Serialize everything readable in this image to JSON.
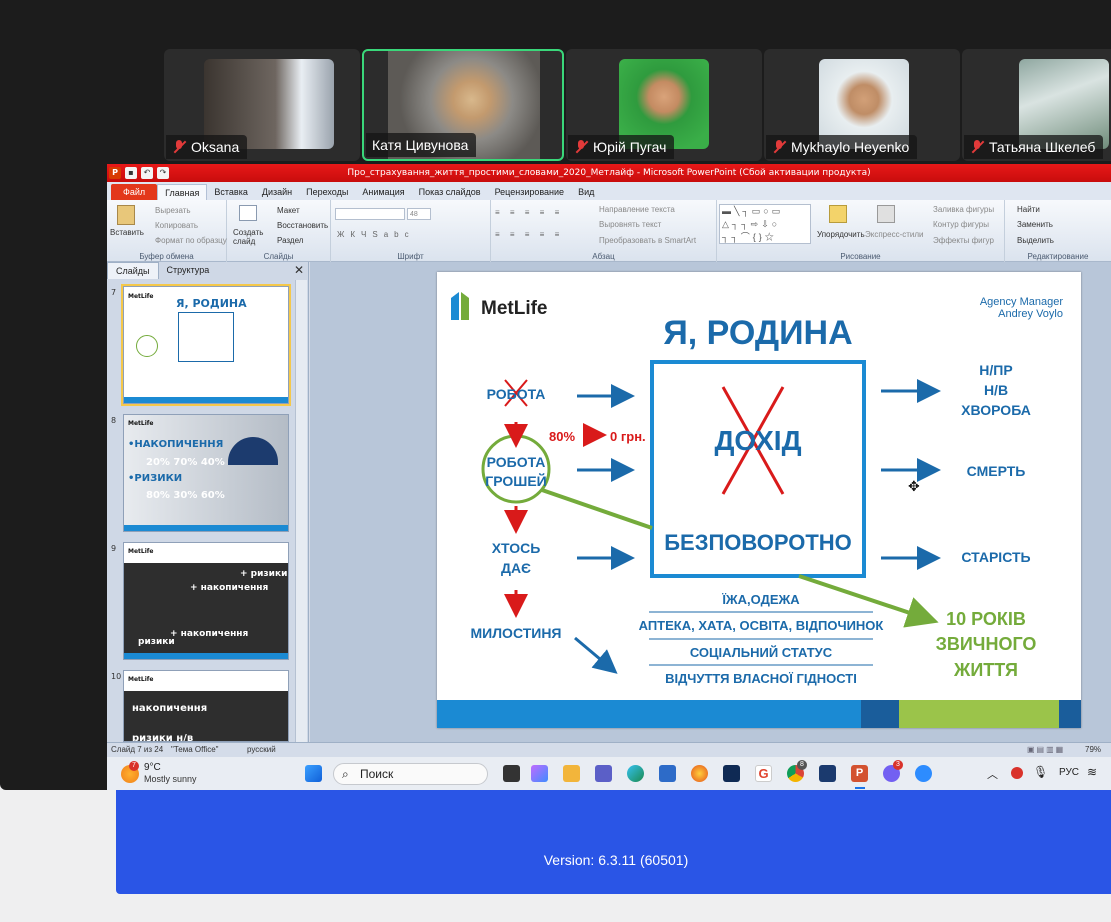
{
  "participants": [
    {
      "name": "Oksana",
      "muted": true
    },
    {
      "name": "Катя Цивунова",
      "muted": false,
      "active": true
    },
    {
      "name": "Юрій Пугач",
      "muted": true
    },
    {
      "name": "Mykhaylo Heyenko",
      "muted": true
    },
    {
      "name": "Татьяна Шкелеб",
      "muted": true
    }
  ],
  "ppt": {
    "title": "Про_страхування_життя_простими_словами_2020_Метлайф - Microsoft PowerPoint (Сбой активации продукта)",
    "tabs": [
      "Файл",
      "Главная",
      "Вставка",
      "Дизайн",
      "Переходы",
      "Анимация",
      "Показ слайдов",
      "Рецензирование",
      "Вид"
    ],
    "ribbon": {
      "clipboard": {
        "paste": "Вставить",
        "cut": "Вырезать",
        "copy": "Копировать",
        "format": "Формат по образцу",
        "group": "Буфер обмена"
      },
      "slides": {
        "new": "Создать слайд",
        "layout": "Макет",
        "reset": "Восстановить",
        "section": "Раздел",
        "group": "Слайды"
      },
      "font": {
        "size": "48",
        "group": "Шрифт"
      },
      "paragraph": {
        "dir": "Направление текста",
        "align": "Выровнять текст",
        "smartart": "Преобразовать в SmartArt",
        "group": "Абзац"
      },
      "drawing": {
        "arrange": "Упорядочить",
        "styles": "Экспресс-стили",
        "fill": "Заливка фигуры",
        "outline": "Контур фигуры",
        "effects": "Эффекты фигур",
        "group": "Рисование"
      },
      "editing": {
        "find": "Найти",
        "replace": "Заменить",
        "select": "Выделить",
        "group": "Редактирование"
      }
    },
    "panel_tabs": [
      "Слайды",
      "Структура"
    ],
    "status": {
      "slide": "Слайд 7 из 24",
      "theme": "\"Тема Office\"",
      "lang": "русский",
      "zoom": "79%"
    }
  },
  "thumbs": [
    {
      "num": "7",
      "logo": "MetLife",
      "title": "Я, РОДИНА"
    },
    {
      "num": "8",
      "logo": "MetLife",
      "l1": "•НАКОПИЧЕННЯ",
      "p1": "20% 70% 40%",
      "l2": "•РИЗИКИ",
      "p2": "80% 30% 60%"
    },
    {
      "num": "9",
      "logo": "MetLife",
      "a": "+ ризики",
      "b": "+ накопичення",
      "c": "ризики",
      "d": "+ накопичення"
    },
    {
      "num": "10",
      "logo": "MetLife",
      "a": "накопичення",
      "b": "ризики н/в"
    }
  ],
  "slide": {
    "logo": "MetLife",
    "agency": "Agency Manager",
    "agency_name": "Andrey Voylo",
    "title": "Я, РОДИНА",
    "robota": "РОБОТА",
    "pct": "80%",
    "zero": "0 грн.",
    "money1": "РОБОТА",
    "money2": "ГРОШЕЙ",
    "someone1": "ХТОСЬ",
    "someone2": "ДАЄ",
    "alms": "МИЛОСТИНЯ",
    "income": "ДОХІД",
    "irrevocably": "БЕЗПОВОРОТНО",
    "r1": "Н/ПР",
    "r2": "Н/В",
    "r3": "ХВОРОБА",
    "death": "СМЕРТЬ",
    "age": "СТАРІСТЬ",
    "years1": "10 РОКІВ",
    "years2": "ЗВИЧНОГО",
    "years3": "ЖИТТЯ",
    "list": [
      "ЇЖА,ОДЕЖА",
      "АПТЕКА, ХАТА, ОСВІТА, ВІДПОЧИНОК",
      "СОЦІАЛЬНИЙ СТАТУС",
      "ВІДЧУТТЯ ВЛАСНОЇ ГІДНОСТІ"
    ]
  },
  "taskbar": {
    "temp": "9°C",
    "weather": "Mostly sunny",
    "badge_weather": "7",
    "search": "Поиск",
    "lang": "РУС",
    "badge_chrome": "8",
    "badge_viber": "3"
  },
  "zoom": {
    "version": "Version: 6.3.11 (60501)"
  },
  "colors": {
    "metlife_blue": "#1b6aaa",
    "metlife_green": "#74ab3b",
    "cross_red": "#d91a1a",
    "zoom_blue": "#2a55e6"
  }
}
